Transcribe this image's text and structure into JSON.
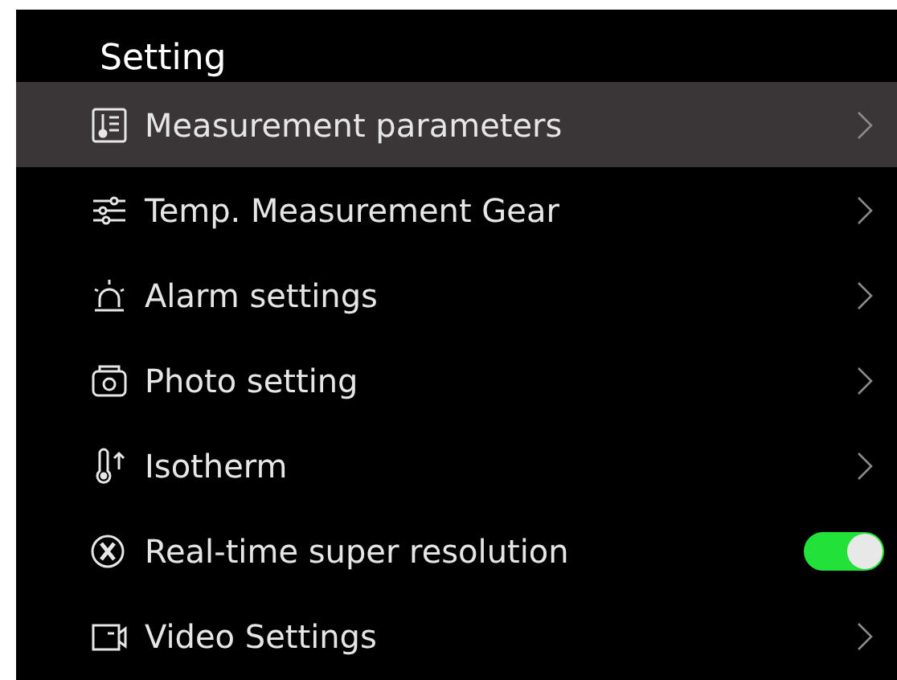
{
  "title": "Setting",
  "items": [
    {
      "label": "Measurement parameters",
      "kind": "submenu",
      "selected": true
    },
    {
      "label": "Temp. Measurement Gear",
      "kind": "submenu",
      "selected": false
    },
    {
      "label": "Alarm settings",
      "kind": "submenu",
      "selected": false
    },
    {
      "label": "Photo setting",
      "kind": "submenu",
      "selected": false
    },
    {
      "label": "Isotherm",
      "kind": "submenu",
      "selected": false
    },
    {
      "label": "Real-time super resolution",
      "kind": "toggle",
      "selected": false,
      "on": true
    },
    {
      "label": "Video Settings",
      "kind": "submenu",
      "selected": false
    }
  ]
}
